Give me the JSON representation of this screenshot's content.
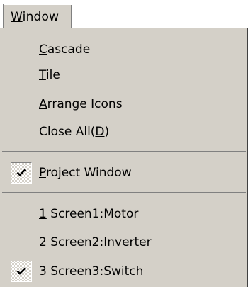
{
  "menubar": {
    "title_access": "W",
    "title_rest": "indow"
  },
  "menu": {
    "cascade": {
      "access": "C",
      "rest": "ascade"
    },
    "tile": {
      "access": "T",
      "rest": "ile"
    },
    "arrange_icons": {
      "access": "A",
      "rest": "rrange Icons"
    },
    "close_all": {
      "pre": "Close All(",
      "access": "D",
      "post": ")"
    },
    "project_window": {
      "access": "P",
      "rest": "roject Window",
      "checked": true
    },
    "windows": [
      {
        "access": "1",
        "rest": " Screen1:Motor",
        "checked": false
      },
      {
        "access": "2",
        "rest": " Screen2:Inverter",
        "checked": false
      },
      {
        "access": "3",
        "rest": " Screen3:Switch",
        "checked": true
      }
    ],
    "check_icon": "checkmark-icon"
  },
  "colors": {
    "menu_bg": "#d4d0c8",
    "separator_dark": "#808080",
    "separator_light": "#ffffff"
  }
}
